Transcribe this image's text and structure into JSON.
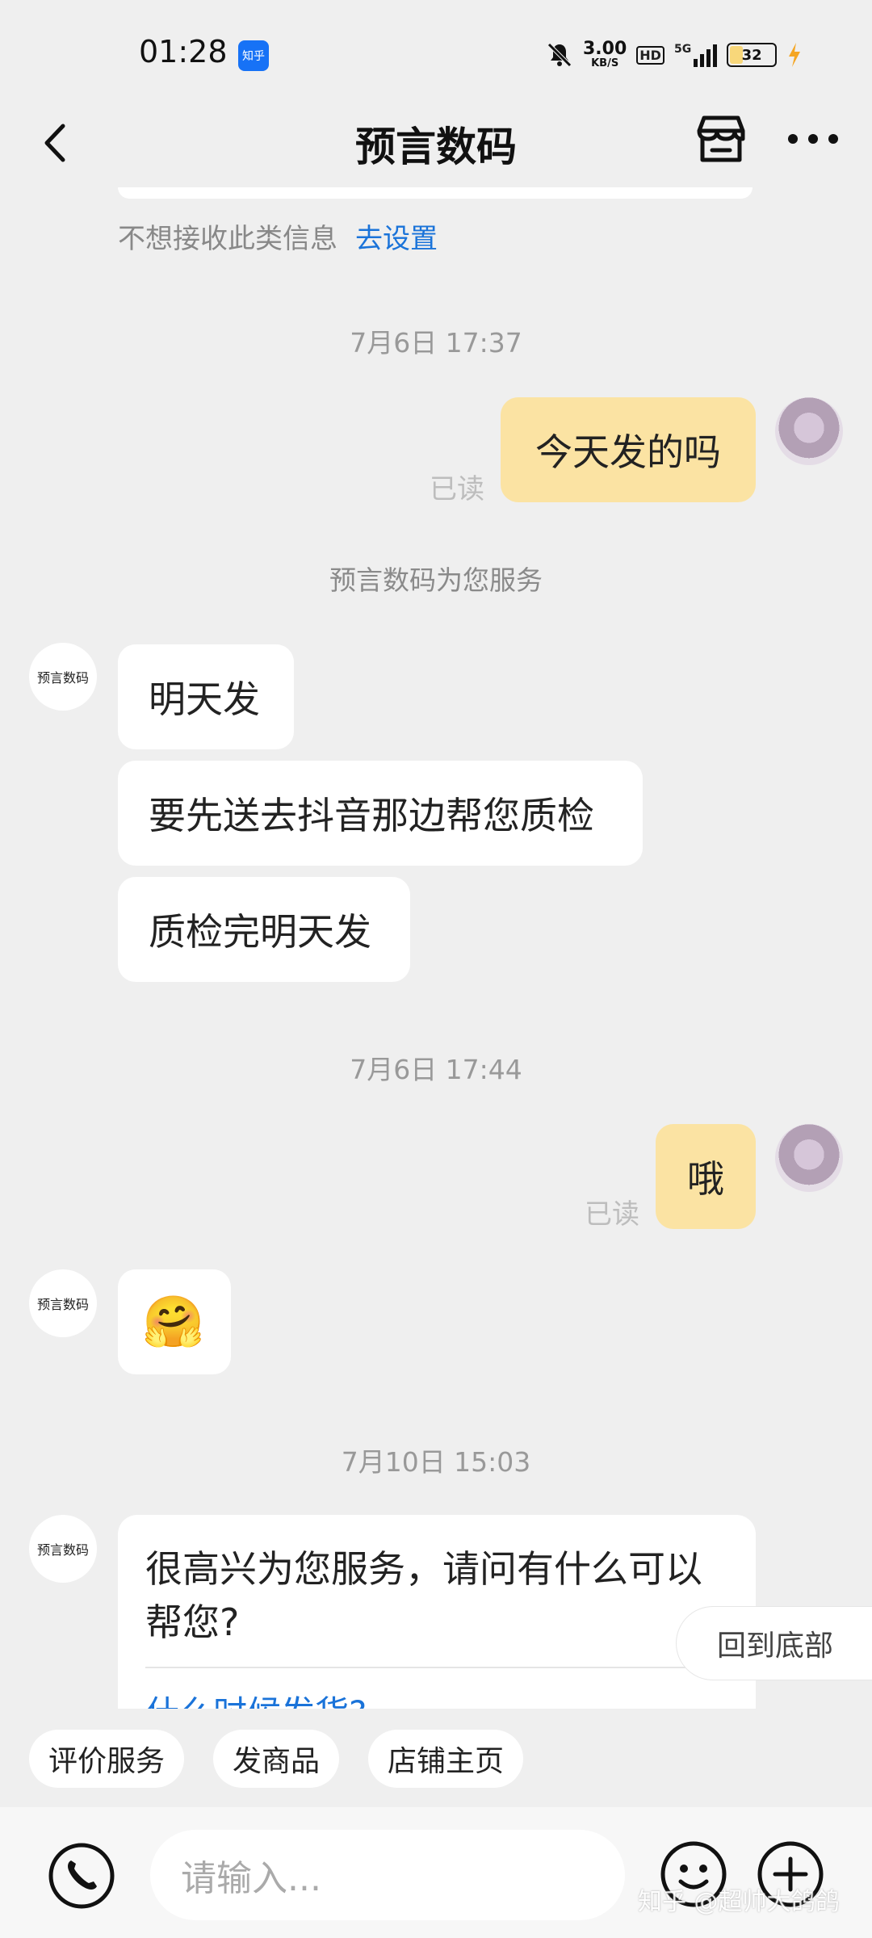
{
  "status_bar": {
    "time": "01:28",
    "app_badge": "知乎",
    "net_speed_value": "3.00",
    "net_speed_unit": "KB/S",
    "hd_label": "HD",
    "network": "5G",
    "battery": "32"
  },
  "header": {
    "title": "预言数码",
    "icons": [
      "back-icon",
      "shop-icon",
      "more-icon"
    ]
  },
  "notice": {
    "text": "不想接收此类信息",
    "link": "去设置"
  },
  "messages": [
    {
      "timestamp": "7月6日 17:37"
    },
    {
      "sender": "user",
      "text": "今天发的吗",
      "read": "已读"
    },
    {
      "system": "预言数码为您服务"
    },
    {
      "sender": "shop",
      "avatar_text": "预言数码",
      "texts": [
        "明天发",
        "要先送去抖音那边帮您质检",
        "质检完明天发"
      ]
    },
    {
      "timestamp": "7月6日 17:44"
    },
    {
      "sender": "user",
      "text": "哦",
      "read": "已读"
    },
    {
      "sender": "shop",
      "avatar_text": "预言数码",
      "emoji": "🤗"
    },
    {
      "timestamp": "7月10日 15:03"
    },
    {
      "sender": "shop",
      "avatar_text": "预言数码",
      "text": "很高兴为您服务，请问有什么可以帮您?",
      "quick_question": "什么时候发货?"
    }
  ],
  "back_to_bottom": "回到底部",
  "quick_actions": [
    "评价服务",
    "发商品",
    "店铺主页"
  ],
  "input": {
    "placeholder": "请输入..."
  },
  "watermark": "知乎 @超帅大鸽鸽",
  "colors": {
    "out_bubble": "#fbe3a3",
    "link": "#1a73d9",
    "background": "#efefef"
  }
}
